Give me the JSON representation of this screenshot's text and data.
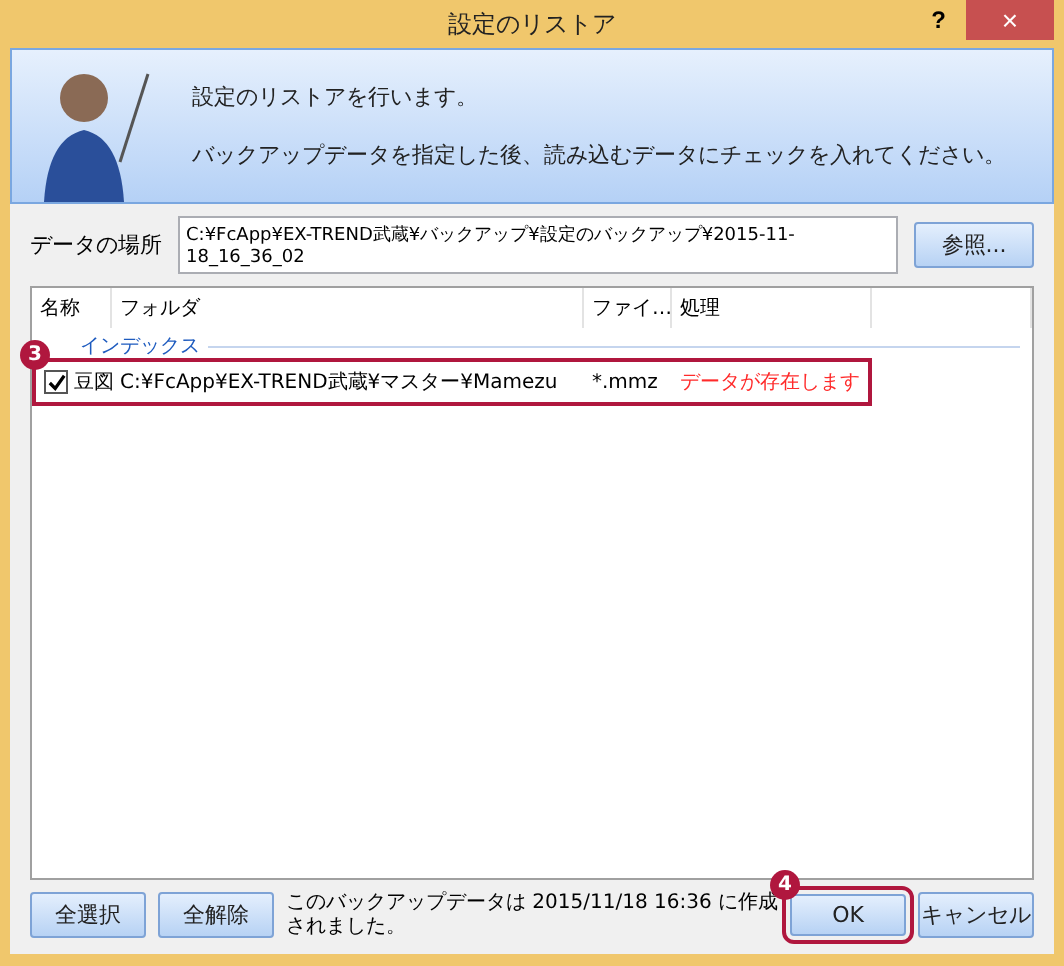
{
  "window": {
    "title": "設定のリストア",
    "help": "?",
    "close": "×"
  },
  "banner": {
    "lines": [
      "設定のリストアを行います。",
      "バックアップデータを指定した後、読み込むデータにチェックを入れてください。"
    ]
  },
  "location": {
    "label": "データの場所",
    "value": "C:¥FcApp¥EX-TREND武蔵¥バックアップ¥設定のバックアップ¥2015-11-18_16_36_02",
    "browse": "参照..."
  },
  "table": {
    "columns": [
      "名称",
      "フォルダ",
      "ファイ…",
      "処理"
    ],
    "group": "インデックス",
    "rows": [
      {
        "checked": true,
        "name": "豆図",
        "folder": "C:¥FcApp¥EX-TREND武蔵¥マスター¥Mamezu",
        "file": "*.mmz",
        "status": "データが存在します",
        "kind": "warning",
        "callout": "3"
      }
    ]
  },
  "footer": {
    "select_all": "全選択",
    "clear_all": "全解除",
    "message": "このバックアップデータは 2015/11/18 16:36 に作成されました。",
    "ok": "OK",
    "ok_callout": "4",
    "cancel": "キャンセル"
  }
}
